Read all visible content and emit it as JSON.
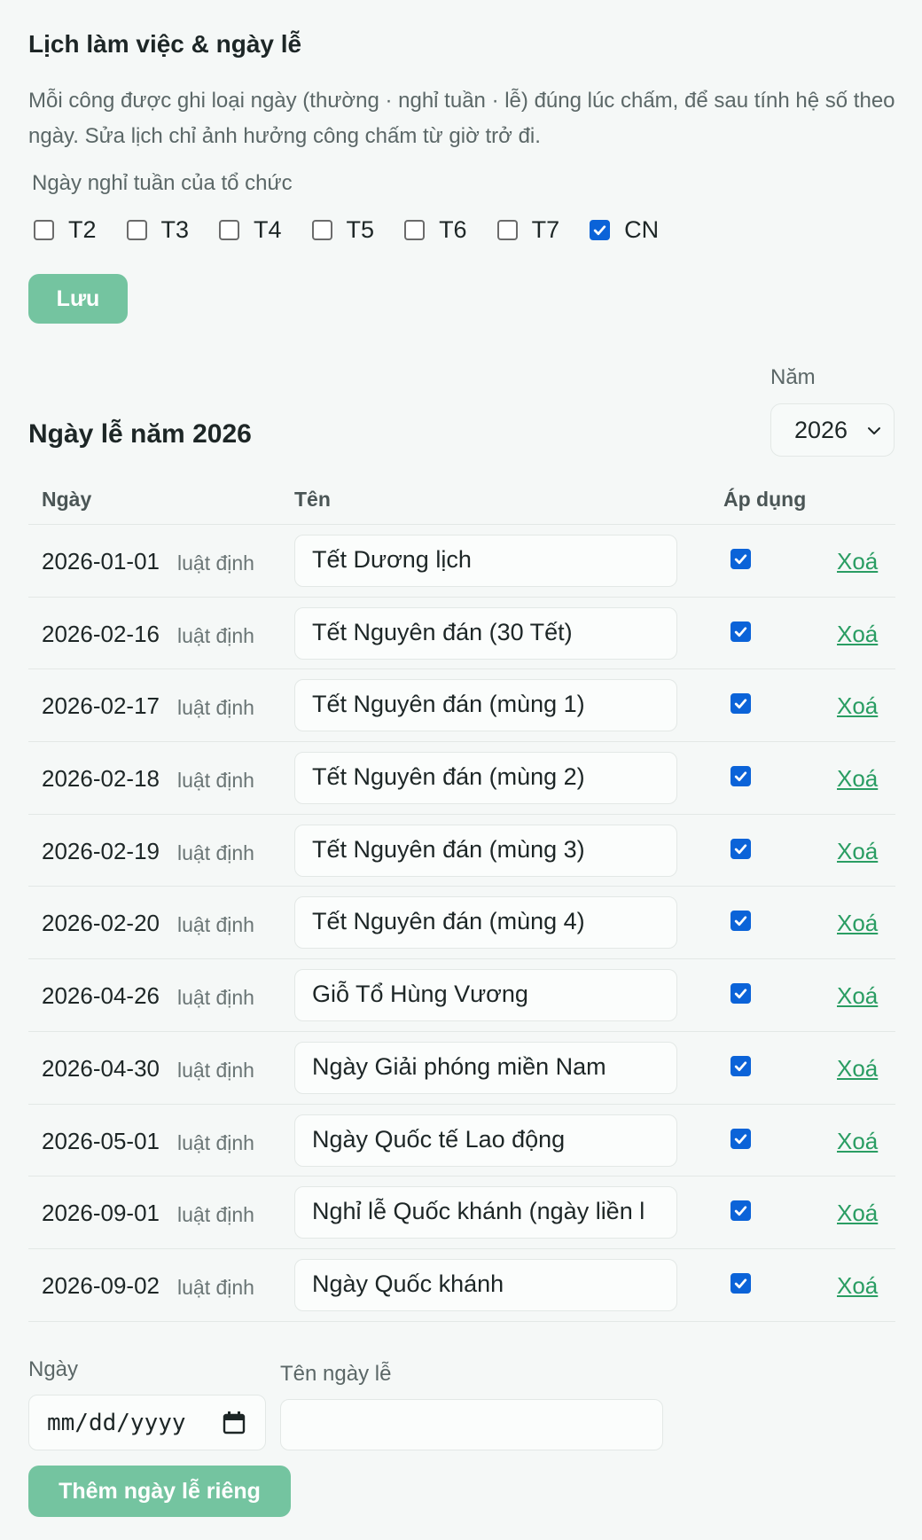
{
  "title": "Lịch làm việc & ngày lễ",
  "description": "Mỗi công được ghi loại ngày (thường · nghỉ tuần · lễ) đúng lúc chấm, để sau tính hệ số theo ngày. Sửa lịch chỉ ảnh hưởng công chấm từ giờ trở đi.",
  "weekly": {
    "label": "Ngày nghỉ tuần của tổ chức",
    "days": [
      {
        "label": "T2",
        "checked": false
      },
      {
        "label": "T3",
        "checked": false
      },
      {
        "label": "T4",
        "checked": false
      },
      {
        "label": "T5",
        "checked": false
      },
      {
        "label": "T6",
        "checked": false
      },
      {
        "label": "T7",
        "checked": false
      },
      {
        "label": "CN",
        "checked": true
      }
    ],
    "save_label": "Lưu"
  },
  "year": {
    "label": "Năm",
    "value": "2026"
  },
  "holidays": {
    "title": "Ngày lễ năm 2026",
    "columns": {
      "date": "Ngày",
      "name": "Tên",
      "apply": "Áp dụng"
    },
    "rows": [
      {
        "date": "2026-01-01",
        "tag": "luật định",
        "name": "Tết Dương lịch",
        "applied": true,
        "delete": "Xoá"
      },
      {
        "date": "2026-02-16",
        "tag": "luật định",
        "name": "Tết Nguyên đán (30 Tết)",
        "applied": true,
        "delete": "Xoá"
      },
      {
        "date": "2026-02-17",
        "tag": "luật định",
        "name": "Tết Nguyên đán (mùng 1)",
        "applied": true,
        "delete": "Xoá"
      },
      {
        "date": "2026-02-18",
        "tag": "luật định",
        "name": "Tết Nguyên đán (mùng 2)",
        "applied": true,
        "delete": "Xoá"
      },
      {
        "date": "2026-02-19",
        "tag": "luật định",
        "name": "Tết Nguyên đán (mùng 3)",
        "applied": true,
        "delete": "Xoá"
      },
      {
        "date": "2026-02-20",
        "tag": "luật định",
        "name": "Tết Nguyên đán (mùng 4)",
        "applied": true,
        "delete": "Xoá"
      },
      {
        "date": "2026-04-26",
        "tag": "luật định",
        "name": "Giỗ Tổ Hùng Vương",
        "applied": true,
        "delete": "Xoá"
      },
      {
        "date": "2026-04-30",
        "tag": "luật định",
        "name": "Ngày Giải phóng miền Nam",
        "applied": true,
        "delete": "Xoá"
      },
      {
        "date": "2026-05-01",
        "tag": "luật định",
        "name": "Ngày Quốc tế Lao động",
        "applied": true,
        "delete": "Xoá"
      },
      {
        "date": "2026-09-01",
        "tag": "luật định",
        "name": "Nghỉ lễ Quốc khánh (ngày liền l",
        "applied": true,
        "delete": "Xoá"
      },
      {
        "date": "2026-09-02",
        "tag": "luật định",
        "name": "Ngày Quốc khánh",
        "applied": true,
        "delete": "Xoá"
      }
    ]
  },
  "add_form": {
    "date_label": "Ngày",
    "date_placeholder": "mm/dd/yyyy",
    "name_label": "Tên ngày lễ",
    "name_value": "",
    "add_label": "Thêm ngày lễ riêng"
  },
  "colors": {
    "accent": "#74c4a0",
    "link": "#2a9d63",
    "checkbox": "#0b63d8"
  }
}
